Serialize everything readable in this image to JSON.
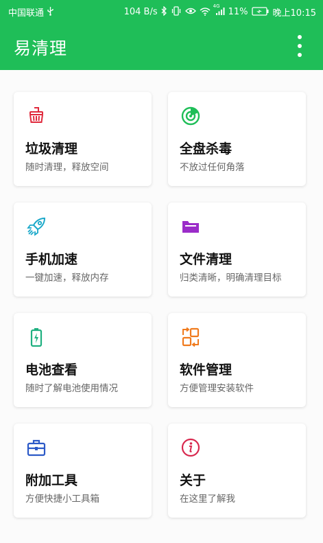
{
  "status_bar": {
    "carrier": "中国联通",
    "usb_icon": "usb-icon",
    "speed": "104 B/s",
    "network_type": "4G",
    "battery_percent": "11%",
    "time": "晚上10:15"
  },
  "app_bar": {
    "title": "易清理",
    "menu_icon": "more-vert-icon"
  },
  "colors": {
    "primary": "#1fbe58",
    "junk": "#e0283b",
    "scan": "#1fbe58",
    "rocket": "#1aa8c9",
    "folder": "#9b2cc9",
    "battery": "#1fb080",
    "apps": "#f07a1c",
    "toolbox": "#2b59c7",
    "info": "#d8284e"
  },
  "cards": [
    {
      "title": "垃圾清理",
      "subtitle": "随时清理，释放空间",
      "icon": "broom-basket-icon"
    },
    {
      "title": "全盘杀毒",
      "subtitle": "不放过任何角落",
      "icon": "radar-scan-icon"
    },
    {
      "title": "手机加速",
      "subtitle": "一键加速，释放内存",
      "icon": "rocket-icon"
    },
    {
      "title": "文件清理",
      "subtitle": "归类清晰，明确清理目标",
      "icon": "folder-icon"
    },
    {
      "title": "电池查看",
      "subtitle": "随时了解电池使用情况",
      "icon": "battery-icon"
    },
    {
      "title": "软件管理",
      "subtitle": "方便管理安装软件",
      "icon": "app-manage-icon"
    },
    {
      "title": "附加工具",
      "subtitle": "方便快捷小工具箱",
      "icon": "toolbox-icon"
    },
    {
      "title": "关于",
      "subtitle": "在这里了解我",
      "icon": "info-icon"
    }
  ]
}
